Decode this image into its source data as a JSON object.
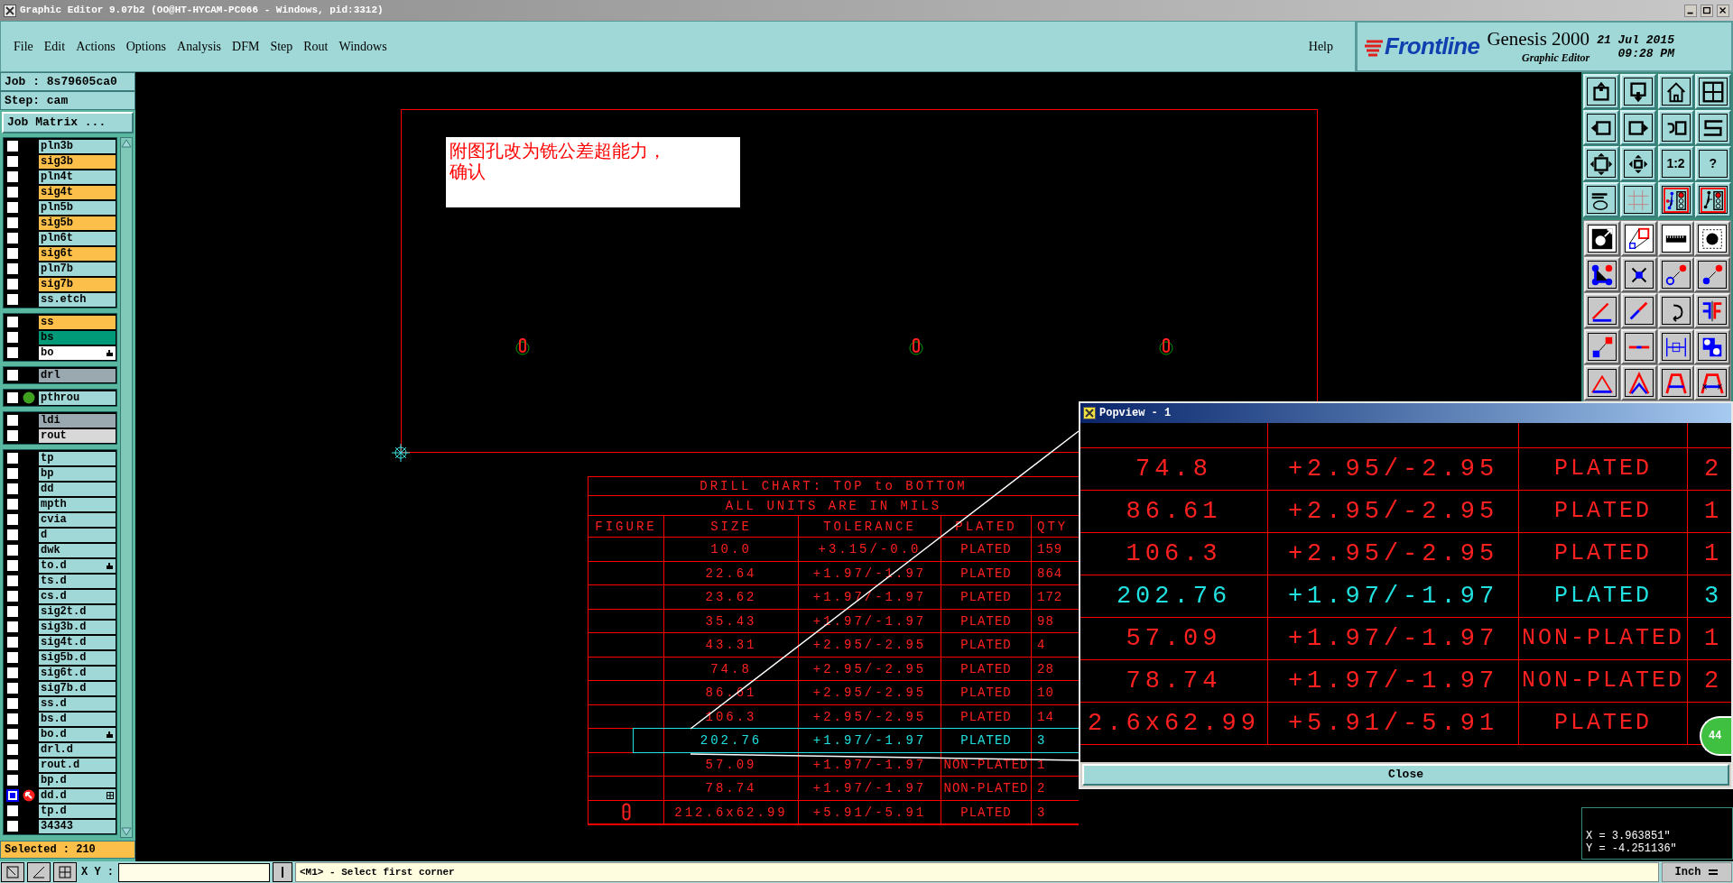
{
  "window": {
    "title": "Graphic Editor 9.07b2 (OO@HT-HYCAM-PC066 - Windows, pid:3312)"
  },
  "menu": [
    "File",
    "Edit",
    "Actions",
    "Options",
    "Analysis",
    "DFM",
    "Step",
    "Rout",
    "Windows"
  ],
  "help": "Help",
  "brand": {
    "logo": "Frontline",
    "product": "Genesis 2000",
    "subtitle": "Graphic Editor",
    "date": "21 Jul 2015",
    "time": "09:28 PM"
  },
  "job": {
    "job": "Job : 8s79605ca0",
    "step": "Step: cam",
    "matrix_button": "Job Matrix ..."
  },
  "layer_groups": [
    {
      "layers": [
        {
          "name": "pln3b",
          "color": "#a0d8d8",
          "kind": "plain",
          "selected": false
        },
        {
          "name": "sig3b",
          "color": "#fcc04a",
          "kind": "plain",
          "selected": false
        },
        {
          "name": "pln4t",
          "color": "#a0d8d8",
          "kind": "plain",
          "selected": false
        },
        {
          "name": "sig4t",
          "color": "#fcc04a",
          "kind": "plain",
          "selected": false
        },
        {
          "name": "pln5b",
          "color": "#a0d8d8",
          "kind": "plain",
          "selected": false
        },
        {
          "name": "sig5b",
          "color": "#fcc04a",
          "kind": "plain",
          "selected": false
        },
        {
          "name": "pln6t",
          "color": "#a0d8d8",
          "kind": "plain",
          "selected": false
        },
        {
          "name": "sig6t",
          "color": "#fcc04a",
          "kind": "plain",
          "selected": false
        },
        {
          "name": "pln7b",
          "color": "#a0d8d8",
          "kind": "plain",
          "selected": false
        },
        {
          "name": "sig7b",
          "color": "#fcc04a",
          "kind": "plain",
          "selected": false
        },
        {
          "name": "ss.etch",
          "color": "#a0d8d8",
          "kind": "plain",
          "selected": false
        }
      ]
    },
    {
      "layers": [
        {
          "name": "ss",
          "color": "#fcc04a",
          "kind": "plain",
          "selected": false
        },
        {
          "name": "bs",
          "color": "#009a78",
          "kind": "plain",
          "selected": false
        },
        {
          "name": "bo",
          "color": "#ffffff",
          "kind": "hand",
          "selected": false
        }
      ]
    },
    {
      "layers": [
        {
          "name": "drl",
          "color": "#9aa8b0",
          "kind": "plain",
          "selected": false
        }
      ]
    },
    {
      "layers": [
        {
          "name": "pthrou",
          "color": "#a0d8d8",
          "kind": "dot",
          "selected": false
        }
      ]
    },
    {
      "layers": [
        {
          "name": "ldi",
          "color": "#9aa8b0",
          "kind": "plain",
          "selected": false
        },
        {
          "name": "rout",
          "color": "#d8d8d8",
          "kind": "plain",
          "selected": false
        }
      ]
    },
    {
      "layers": [
        {
          "name": "tp",
          "color": "#a0d8d8",
          "kind": "plain",
          "selected": false
        },
        {
          "name": "bp",
          "color": "#a0d8d8",
          "kind": "plain",
          "selected": false
        },
        {
          "name": "dd",
          "color": "#a0d8d8",
          "kind": "plain",
          "selected": false
        },
        {
          "name": "mpth",
          "color": "#a0d8d8",
          "kind": "plain",
          "selected": false
        },
        {
          "name": "cvia",
          "color": "#a0d8d8",
          "kind": "plain",
          "selected": false
        },
        {
          "name": "d",
          "color": "#a0d8d8",
          "kind": "plain",
          "selected": false
        },
        {
          "name": "dwk",
          "color": "#a0d8d8",
          "kind": "plain",
          "selected": false
        },
        {
          "name": "to.d",
          "color": "#a0d8d8",
          "kind": "hand",
          "selected": false
        },
        {
          "name": "ts.d",
          "color": "#a0d8d8",
          "kind": "plain",
          "selected": false
        },
        {
          "name": "cs.d",
          "color": "#a0d8d8",
          "kind": "plain",
          "selected": false
        },
        {
          "name": "sig2t.d",
          "color": "#a0d8d8",
          "kind": "plain",
          "selected": false
        },
        {
          "name": "sig3b.d",
          "color": "#a0d8d8",
          "kind": "plain",
          "selected": false
        },
        {
          "name": "sig4t.d",
          "color": "#a0d8d8",
          "kind": "plain",
          "selected": false
        },
        {
          "name": "sig5b.d",
          "color": "#a0d8d8",
          "kind": "plain",
          "selected": false
        },
        {
          "name": "sig6t.d",
          "color": "#a0d8d8",
          "kind": "plain",
          "selected": false
        },
        {
          "name": "sig7b.d",
          "color": "#a0d8d8",
          "kind": "plain",
          "selected": false
        },
        {
          "name": "ss.d",
          "color": "#a0d8d8",
          "kind": "plain",
          "selected": false
        },
        {
          "name": "bs.d",
          "color": "#a0d8d8",
          "kind": "plain",
          "selected": false
        },
        {
          "name": "bo.d",
          "color": "#a0d8d8",
          "kind": "hand",
          "selected": false
        },
        {
          "name": "drl.d",
          "color": "#a0d8d8",
          "kind": "plain",
          "selected": false
        },
        {
          "name": "rout.d",
          "color": "#a0d8d8",
          "kind": "plain",
          "selected": false
        },
        {
          "name": "bp.d",
          "color": "#a0d8d8",
          "kind": "plain",
          "selected": false
        },
        {
          "name": "dd.d",
          "color": "#a0d8d8",
          "kind": "work",
          "selected": true
        },
        {
          "name": "tp.d",
          "color": "#a0d8d8",
          "kind": "plain",
          "selected": false
        },
        {
          "name": "34343",
          "color": "#a0d8d8",
          "kind": "plain",
          "selected": false
        }
      ]
    }
  ],
  "selected_count": "Selected : 210",
  "tool_labels": {
    "ratio": "1:2",
    "help": "?"
  },
  "note": "附图孔改为铣公差超能力，确认",
  "drill_chart": {
    "title": "DRILL CHART: TOP to BOTTOM",
    "subtitle": "ALL UNITS ARE IN MILS",
    "columns": [
      "FIGURE",
      "SIZE",
      "TOLERANCE",
      "PLATED",
      "QTY"
    ],
    "rows": [
      {
        "size": "10.0",
        "tolerance": "+3.15/-0.0",
        "plated": "PLATED",
        "qty": "159",
        "selected": false,
        "figure": false
      },
      {
        "size": "22.64",
        "tolerance": "+1.97/-1.97",
        "plated": "PLATED",
        "qty": "864",
        "selected": false,
        "figure": false
      },
      {
        "size": "23.62",
        "tolerance": "+1.97/-1.97",
        "plated": "PLATED",
        "qty": "172",
        "selected": false,
        "figure": false
      },
      {
        "size": "35.43",
        "tolerance": "+1.97/-1.97",
        "plated": "PLATED",
        "qty": "98",
        "selected": false,
        "figure": false
      },
      {
        "size": "43.31",
        "tolerance": "+2.95/-2.95",
        "plated": "PLATED",
        "qty": "4",
        "selected": false,
        "figure": false
      },
      {
        "size": "74.8",
        "tolerance": "+2.95/-2.95",
        "plated": "PLATED",
        "qty": "28",
        "selected": false,
        "figure": false
      },
      {
        "size": "86.61",
        "tolerance": "+2.95/-2.95",
        "plated": "PLATED",
        "qty": "10",
        "selected": false,
        "figure": false
      },
      {
        "size": "106.3",
        "tolerance": "+2.95/-2.95",
        "plated": "PLATED",
        "qty": "14",
        "selected": false,
        "figure": false
      },
      {
        "size": "202.76",
        "tolerance": "+1.97/-1.97",
        "plated": "PLATED",
        "qty": "3",
        "selected": true,
        "figure": false
      },
      {
        "size": "57.09",
        "tolerance": "+1.97/-1.97",
        "plated": "NON-PLATED",
        "qty": "1",
        "selected": false,
        "figure": false
      },
      {
        "size": "78.74",
        "tolerance": "+1.97/-1.97",
        "plated": "NON-PLATED",
        "qty": "2",
        "selected": false,
        "figure": false
      },
      {
        "size": "212.6x62.99",
        "tolerance": "+5.91/-5.91",
        "plated": "PLATED",
        "qty": "3",
        "selected": false,
        "figure": true
      }
    ]
  },
  "popview": {
    "title": "Popview - 1",
    "rows": [
      {
        "size": "74.8",
        "tolerance": "+2.95/-2.95",
        "plated": "PLATED",
        "qty": "2",
        "selected": false
      },
      {
        "size": "86.61",
        "tolerance": "+2.95/-2.95",
        "plated": "PLATED",
        "qty": "1",
        "selected": false
      },
      {
        "size": "106.3",
        "tolerance": "+2.95/-2.95",
        "plated": "PLATED",
        "qty": "1",
        "selected": false
      },
      {
        "size": "202.76",
        "tolerance": "+1.97/-1.97",
        "plated": "PLATED",
        "qty": "3",
        "selected": true
      },
      {
        "size": "57.09",
        "tolerance": "+1.97/-1.97",
        "plated": "NON-PLATED",
        "qty": "1",
        "selected": false
      },
      {
        "size": "78.74",
        "tolerance": "+1.97/-1.97",
        "plated": "NON-PLATED",
        "qty": "2",
        "selected": false
      },
      {
        "size": "2.6x62.99",
        "tolerance": "+5.91/-5.91",
        "plated": "PLATED",
        "qty": "",
        "selected": false
      }
    ],
    "badge": "44",
    "close": "Close"
  },
  "coordinates": {
    "x": "X = 3.963851\"",
    "y": "Y = -4.251136\""
  },
  "status_bar": {
    "xy_label": "X Y :",
    "message": "<M1> - Select first corner",
    "units": "Inch"
  }
}
